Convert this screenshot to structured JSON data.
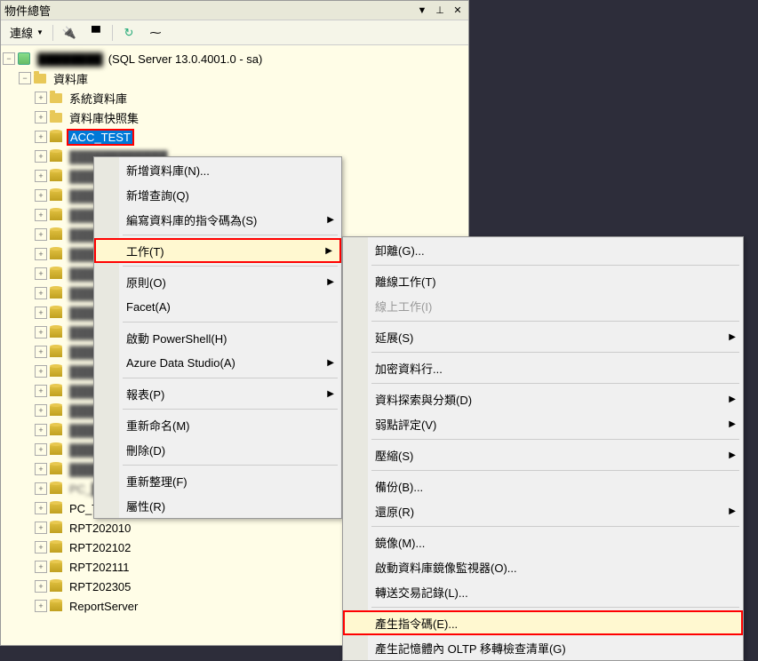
{
  "panel": {
    "title": "物件總管",
    "window_icons": {
      "dropdown": "▼",
      "pin": "📌",
      "close": "✕"
    }
  },
  "toolbar": {
    "connect_label": "連線",
    "refresh_title": "重新整理"
  },
  "tree": {
    "server": "(SQL Server 13.0.4001.0 - sa)",
    "databases_label": "資料庫",
    "system_db_label": "系統資料庫",
    "snapshot_label": "資料庫快照集",
    "selected_db": "ACC_TEST",
    "visible": [
      "PC_TEST",
      "RPT202010",
      "RPT202102",
      "RPT202111",
      "RPT202305",
      "ReportServer"
    ],
    "blurred_count": 17
  },
  "context_menu": {
    "main": [
      {
        "label": "新增資料庫(N)...",
        "arrow": false
      },
      {
        "label": "新增查詢(Q)",
        "arrow": false
      },
      {
        "label": "編寫資料庫的指令碼為(S)",
        "arrow": true
      },
      {
        "sep": true
      },
      {
        "label": "工作(T)",
        "arrow": true,
        "highlight": true
      },
      {
        "sep": true
      },
      {
        "label": "原則(O)",
        "arrow": true
      },
      {
        "label": "Facet(A)",
        "arrow": false
      },
      {
        "sep": true
      },
      {
        "label": "啟動 PowerShell(H)",
        "arrow": false
      },
      {
        "label": "Azure Data Studio(A)",
        "arrow": true
      },
      {
        "sep": true
      },
      {
        "label": "報表(P)",
        "arrow": true
      },
      {
        "sep": true
      },
      {
        "label": "重新命名(M)",
        "arrow": false
      },
      {
        "label": "刪除(D)",
        "arrow": false
      },
      {
        "sep": true
      },
      {
        "label": "重新整理(F)",
        "arrow": false
      },
      {
        "label": "屬性(R)",
        "arrow": false
      }
    ],
    "sub": [
      {
        "label": "卸離(G)...",
        "arrow": false
      },
      {
        "sep": true
      },
      {
        "label": "離線工作(T)",
        "arrow": false
      },
      {
        "label": "線上工作(I)",
        "arrow": false,
        "disabled": true
      },
      {
        "sep": true
      },
      {
        "label": "延展(S)",
        "arrow": true
      },
      {
        "sep": true
      },
      {
        "label": "加密資料行...",
        "arrow": false
      },
      {
        "sep": true
      },
      {
        "label": "資料探索與分類(D)",
        "arrow": true
      },
      {
        "label": "弱點評定(V)",
        "arrow": true
      },
      {
        "sep": true
      },
      {
        "label": "壓縮(S)",
        "arrow": true
      },
      {
        "sep": true
      },
      {
        "label": "備份(B)...",
        "arrow": false
      },
      {
        "label": "還原(R)",
        "arrow": true
      },
      {
        "sep": true
      },
      {
        "label": "鏡像(M)...",
        "arrow": false
      },
      {
        "label": "啟動資料庫鏡像監視器(O)...",
        "arrow": false
      },
      {
        "label": "轉送交易記錄(L)...",
        "arrow": false
      },
      {
        "sep": true
      },
      {
        "label": "產生指令碼(E)...",
        "arrow": false,
        "highlight": true
      },
      {
        "label": "產生記憶體內 OLTP 移轉檢查清單(G)",
        "arrow": false
      }
    ]
  }
}
